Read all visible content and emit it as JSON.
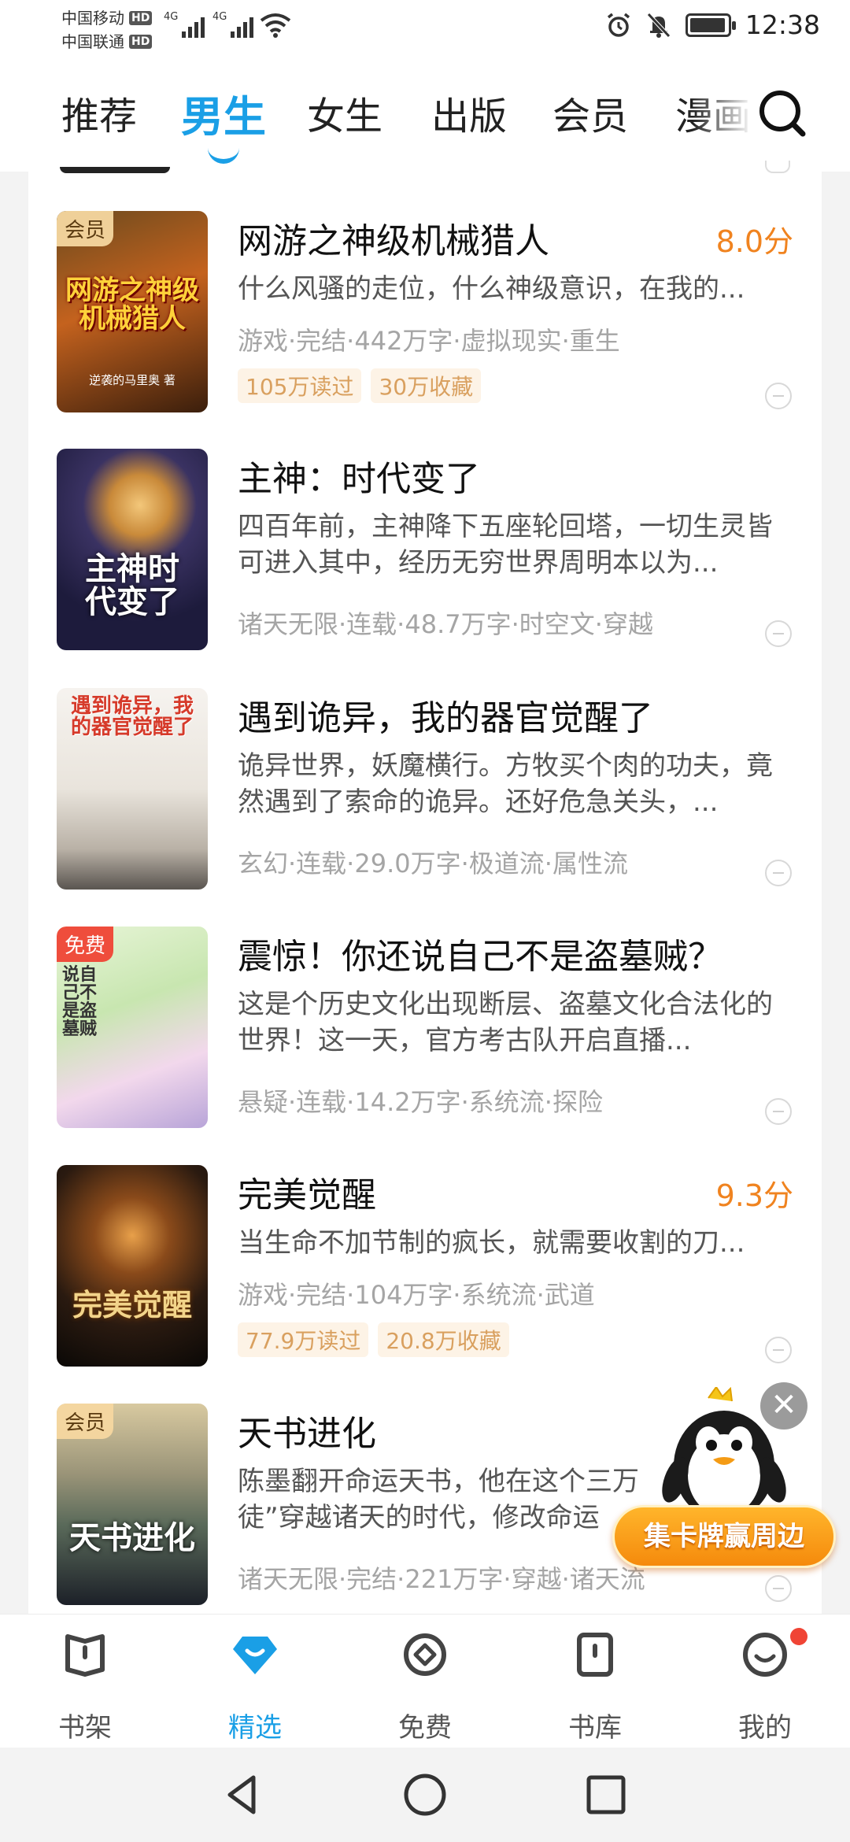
{
  "status_bar": {
    "carrier1": "中国移动",
    "carrier2": "中国联通",
    "hd": "HD",
    "net1": "4G",
    "net2": "4G",
    "time": "12:38"
  },
  "top_tabs": [
    "推荐",
    "男生",
    "女生",
    "出版",
    "会员",
    "漫画"
  ],
  "active_top_tab": "男生",
  "books": [
    {
      "title": "网游之神级机械猎人",
      "score": "8.0分",
      "desc": "什么风骚的走位，什么神级意识，在我的...",
      "meta": "游戏·完结·442万字·虚拟现实·重生",
      "tags": [
        "105万读过",
        "30万收藏"
      ],
      "badge": "会员",
      "cover_text": "网游之神级机械猎人",
      "cover_author": "逆袭的马里奥 著"
    },
    {
      "title": "主神：时代变了",
      "score": "",
      "desc": "四百年前，主神降下五座轮回塔，一切生灵皆可进入其中，经历无穷世界周明本以为...",
      "meta": "诸天无限·连载·48.7万字·时空文·穿越",
      "tags": [],
      "badge": "",
      "cover_text": "主神时代变了"
    },
    {
      "title": "遇到诡异，我的器官觉醒了",
      "score": "",
      "desc": "诡异世界，妖魔横行。方牧买个肉的功夫，竟然遇到了索命的诡异。还好危急关头，...",
      "meta": "玄幻·连载·29.0万字·极道流·属性流",
      "tags": [],
      "badge": "",
      "cover_text": "遇到诡异，我的器官觉醒了"
    },
    {
      "title": "震惊！你还说自己不是盗墓贼？",
      "score": "",
      "desc": "这是个历史文化出现断层、盗墓文化合法化的世界！这一天，官方考古队开启直播...",
      "meta": "悬疑·连载·14.2万字·系统流·探险",
      "tags": [],
      "badge": "免费",
      "cover_text": "说自己不是盗墓贼"
    },
    {
      "title": "完美觉醒",
      "score": "9.3分",
      "desc": "当生命不加节制的疯长，就需要收割的刀...",
      "meta": "游戏·完结·104万字·系统流·武道",
      "tags": [
        "77.9万读过",
        "20.8万收藏"
      ],
      "badge": "",
      "cover_text": "完美觉醒"
    },
    {
      "title": "天书进化",
      "score": "",
      "desc": "陈墨翻开命运天书，他在这个三万徒”穿越诸天的时代，修改命运",
      "meta": "诸天无限·完结·221万字·穿越·诸天流",
      "tags": [],
      "badge": "会员",
      "cover_text": "天书进化"
    }
  ],
  "promo": {
    "label": "集卡牌赢周边",
    "close": "✕"
  },
  "bottom_nav": [
    "书架",
    "精选",
    "免费",
    "书库",
    "我的"
  ],
  "active_bottom_nav": "精选",
  "colors": {
    "accent": "#1a9fe6",
    "score": "#f0831f",
    "tag_bg": "#fdf3e6",
    "tag_text": "#d9a05f",
    "notify_dot": "#f04435"
  }
}
